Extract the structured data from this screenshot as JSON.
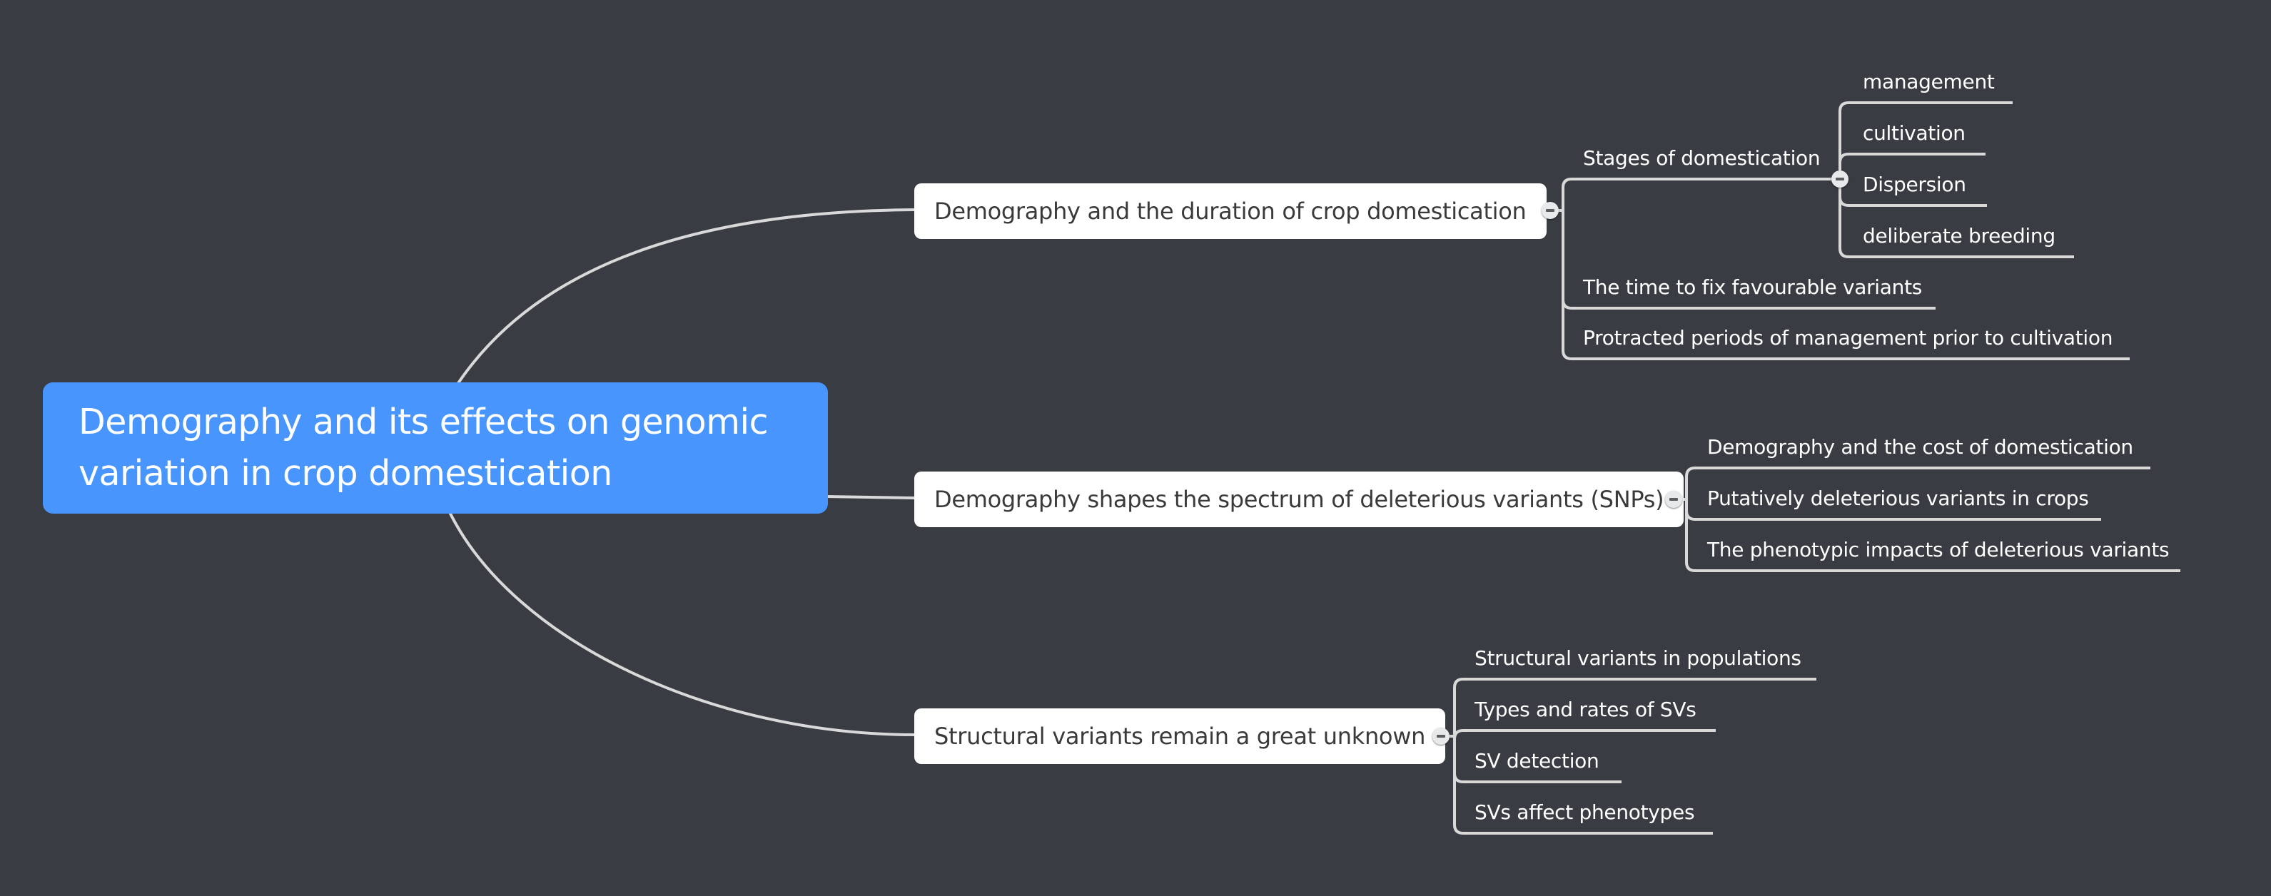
{
  "central_topic": "Demography and its effects on genomic variation in crop domestication",
  "colors": {
    "background": "#393c42",
    "central": "#4896fd",
    "branch_bg": "#ffffff",
    "line": "#d9d9d9"
  },
  "branches": [
    {
      "label": "Demography and the duration of crop domestication",
      "children": [
        {
          "label": "Stages of domestication",
          "children": [
            {
              "label": "management"
            },
            {
              "label": "cultivation"
            },
            {
              "label": "Dispersion"
            },
            {
              "label": "deliberate breeding"
            }
          ]
        },
        {
          "label": "The time to fix favourable variants"
        },
        {
          "label": "Protracted periods of management prior to cultivation"
        }
      ]
    },
    {
      "label": "Demography shapes the spectrum of deleterious variants (SNPs)",
      "children": [
        {
          "label": "Demography and the cost of domestication"
        },
        {
          "label": "Putatively deleterious variants in crops"
        },
        {
          "label": "The phenotypic impacts of deleterious variants"
        }
      ]
    },
    {
      "label": "Structural variants remain a great unknown",
      "children": [
        {
          "label": "Structural variants in populations"
        },
        {
          "label": "Types and rates of SVs"
        },
        {
          "label": "SV detection"
        },
        {
          "label": "SVs affect phenotypes"
        }
      ]
    }
  ],
  "toggle_icon": "collapse-minus-icon"
}
